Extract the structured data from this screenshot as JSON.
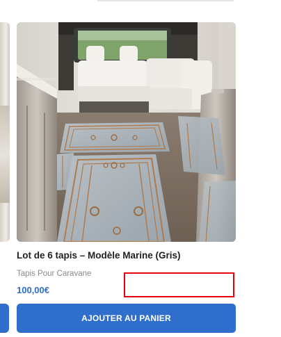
{
  "product": {
    "title": "Lot de 6 tapis – Modèle Marine (Gris)",
    "category": "Tapis Pour Caravane",
    "price": "100,00€",
    "add_to_cart_label": "AJOUTER AU PANIER",
    "image_alt": "Lot de 6 tapis – Modèle Marine (Gris)"
  },
  "colors": {
    "accent": "#2f6ecb",
    "highlight": "#e8000b",
    "title": "#1f1f1f",
    "category": "#8a8a8a"
  }
}
